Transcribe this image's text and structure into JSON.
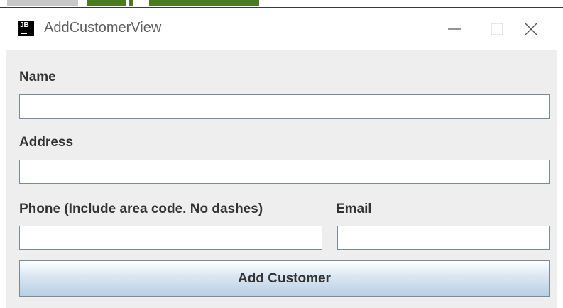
{
  "window": {
    "title": "AddCustomerView",
    "app_icon": "JB",
    "controls": [
      "minimize-icon",
      "maximize-icon",
      "close-icon"
    ]
  },
  "form": {
    "name_label": "Name",
    "name_value": "",
    "address_label": "Address",
    "address_value": "",
    "phone_label": "Phone (Include area code. No dashes)",
    "phone_value": "",
    "email_label": "Email",
    "email_value": "",
    "submit_label": "Add Customer"
  },
  "colors": {
    "panel_bg": "#eeeeee",
    "field_border": "#7a8a99",
    "button_gradient_bottom": "#b8cfe5",
    "taskbar_green": "#4a7a22"
  }
}
